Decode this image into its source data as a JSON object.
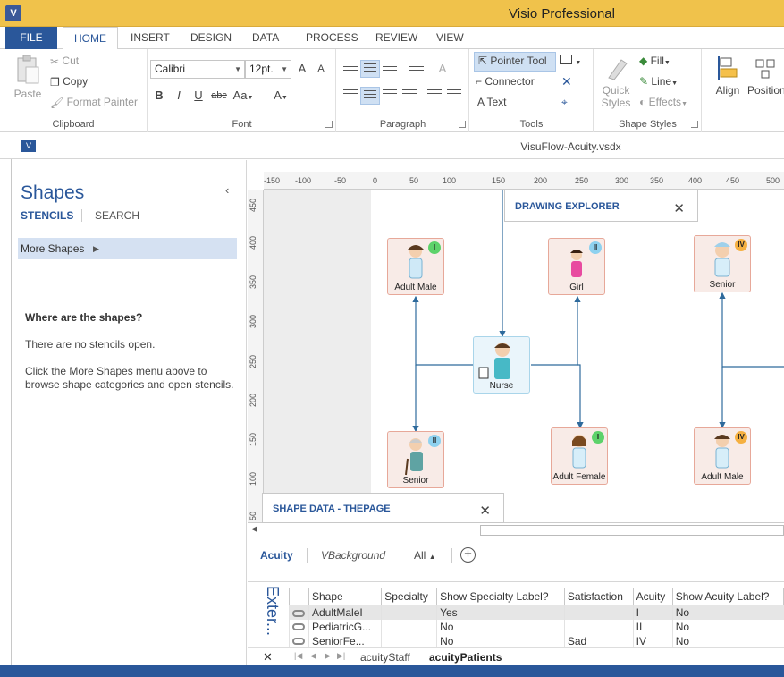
{
  "app": {
    "title": "Visio Professional",
    "icon_letter": "V"
  },
  "tabs": [
    "FILE",
    "HOME",
    "INSERT",
    "DESIGN",
    "DATA",
    "PROCESS",
    "REVIEW",
    "VIEW"
  ],
  "ribbon": {
    "clipboard": {
      "paste": "Paste",
      "cut": "Cut",
      "copy": "Copy",
      "format_painter": "Format Painter",
      "label": "Clipboard"
    },
    "font": {
      "family": "Calibri",
      "size": "12pt.",
      "bold": "B",
      "italic": "I",
      "underline": "U",
      "strike": "abc",
      "case": "Aa",
      "color": "A",
      "grow": "A",
      "shrink": "A",
      "label": "Font"
    },
    "paragraph": {
      "label": "Paragraph"
    },
    "tools": {
      "pointer": "Pointer Tool",
      "connector": "Connector",
      "text": "Text",
      "label": "Tools"
    },
    "shape_styles": {
      "quick_styles_line1": "Quick",
      "quick_styles_line2": "Styles",
      "fill": "Fill",
      "line": "Line",
      "effects": "Effects",
      "label": "Shape Styles"
    },
    "arrange": {
      "align": "Align",
      "position": "Position"
    }
  },
  "document": {
    "title": "VisuFlow-Acuity.vsdx"
  },
  "shapes_panel": {
    "title": "Shapes",
    "tab_stencils": "STENCILS",
    "tab_search": "SEARCH",
    "more_shapes": "More Shapes",
    "where_title": "Where are the shapes?",
    "where_p1": "There are no stencils open.",
    "where_p2": "Click the More Shapes menu above to browse shape categories and open stencils."
  },
  "ruler": {
    "top": [
      "-150",
      "-100",
      "-50",
      "0",
      "50",
      "100",
      "150",
      "200",
      "250",
      "300",
      "350",
      "400",
      "450",
      "500"
    ],
    "left": [
      "450",
      "400",
      "350",
      "300",
      "250",
      "200",
      "150",
      "100",
      "50"
    ]
  },
  "diagram": {
    "shapes": [
      {
        "id": "adult-male-1",
        "label": "Adult Male",
        "badge": "I",
        "badge_color": "#5dd26a"
      },
      {
        "id": "girl",
        "label": "Girl",
        "badge": "II",
        "badge_color": "#8ed1ef"
      },
      {
        "id": "senior-1",
        "label": "Senior",
        "badge": "IV",
        "badge_color": "#f5b041"
      },
      {
        "id": "nurse",
        "label": "Nurse",
        "badge": "",
        "badge_color": ""
      },
      {
        "id": "senior-2",
        "label": "Senior",
        "badge": "II",
        "badge_color": "#8ed1ef"
      },
      {
        "id": "adult-female",
        "label": "Adult Female",
        "badge": "I",
        "badge_color": "#5dd26a"
      },
      {
        "id": "adult-male-2",
        "label": "Adult Male",
        "badge": "IV",
        "badge_color": "#f5b041"
      }
    ]
  },
  "drawing_explorer": {
    "title": "DRAWING EXPLORER"
  },
  "shape_data": {
    "title": "SHAPE DATA - THEPAGE"
  },
  "page_tabs": {
    "acuity": "Acuity",
    "vbackground": "VBackground",
    "all": "All"
  },
  "external_data": {
    "label": "Exter...",
    "columns": [
      "Shape",
      "Specialty",
      "Show Specialty Label?",
      "Satisfaction",
      "Acuity",
      "Show Acuity Label?"
    ],
    "rows": [
      [
        "AdultMaleI",
        "",
        "Yes",
        "",
        "I",
        "No"
      ],
      [
        "PediatricG...",
        "",
        "No",
        "",
        "II",
        "No"
      ],
      [
        "SeniorFe...",
        "",
        "No",
        "Sad",
        "IV",
        "No"
      ]
    ],
    "sheets": [
      "acuityStaff",
      "acuityPatients"
    ]
  },
  "colors": {
    "accent": "#2a579a",
    "title_bar": "#f0c24b",
    "patient_border": "#e7a899",
    "nurse_border": "#a9d5ea"
  }
}
